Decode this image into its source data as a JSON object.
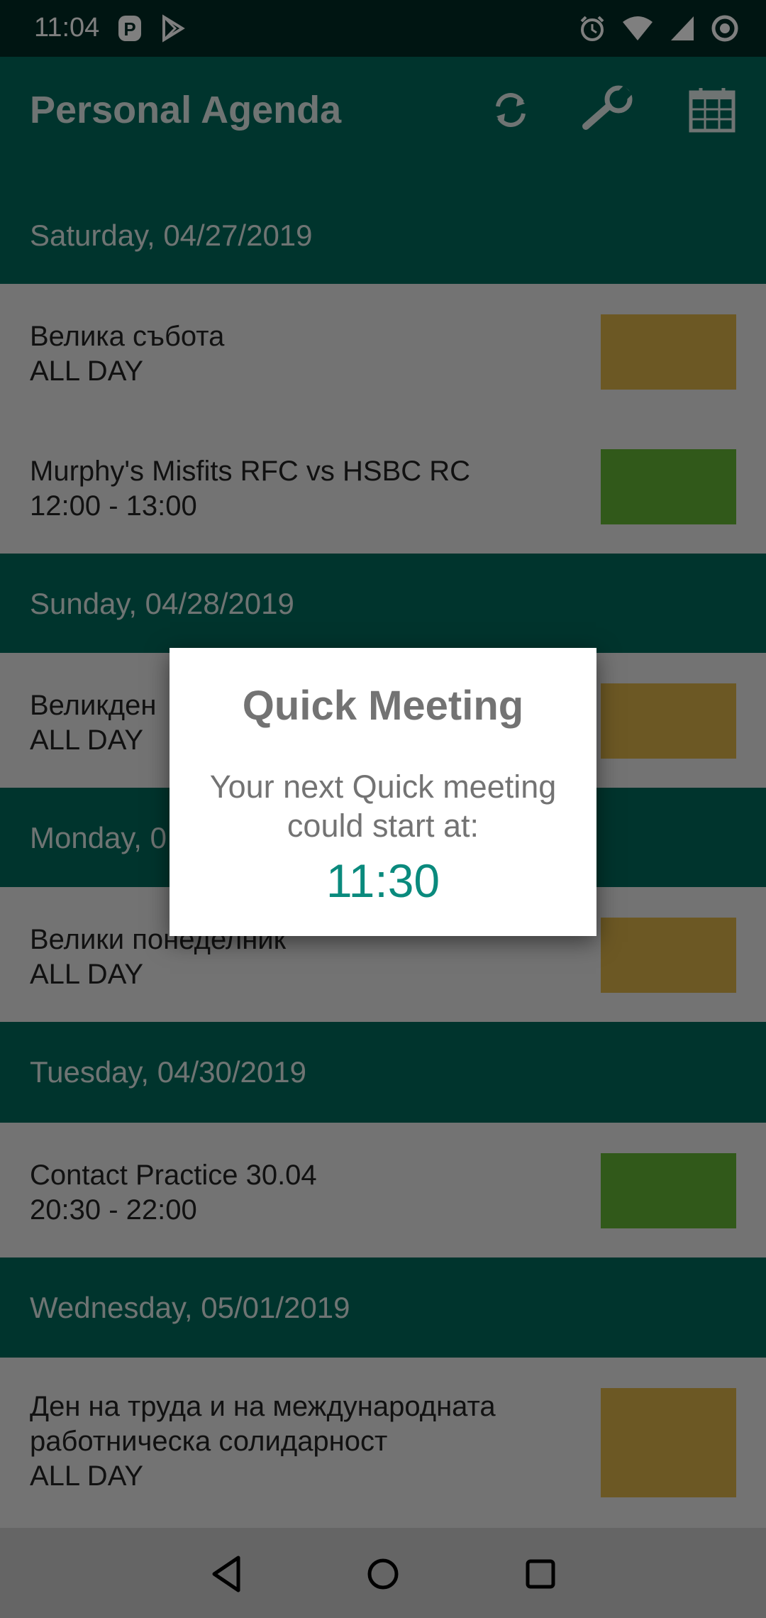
{
  "status_bar": {
    "time": "11:04",
    "left_icons": [
      "parking-icon",
      "play-store-icon"
    ],
    "right_icons": [
      "alarm-icon",
      "wifi-icon",
      "signal-icon",
      "sync-icon"
    ]
  },
  "app_bar": {
    "title": "Personal Agenda",
    "actions": [
      "refresh-icon",
      "wrench-icon",
      "calendar-icon"
    ]
  },
  "agenda": [
    {
      "date": "Saturday, 04/27/2019",
      "events": [
        {
          "title": "Велика събота",
          "time": "ALL DAY",
          "color": "#d9b048"
        },
        {
          "title": "Murphy's Misfits RFC vs HSBC RC",
          "time": "12:00 - 13:00",
          "color": "#62b334"
        }
      ]
    },
    {
      "date": "Sunday, 04/28/2019",
      "events": [
        {
          "title": "Великден",
          "time": "ALL DAY",
          "color": "#d9b048"
        }
      ]
    },
    {
      "date": "Monday, 0",
      "events": [
        {
          "title": "Велики понеделник",
          "time": "ALL DAY",
          "color": "#d9b048"
        }
      ]
    },
    {
      "date": "Tuesday, 04/30/2019",
      "events": [
        {
          "title": "Contact Practice 30.04",
          "time": "20:30 - 22:00",
          "color": "#62b334"
        }
      ]
    },
    {
      "date": "Wednesday, 05/01/2019",
      "events": [
        {
          "title": "Ден на труда и на международната работническа солидарност",
          "time": "ALL DAY",
          "color": "#d9b048"
        }
      ]
    }
  ],
  "dialog": {
    "title": "Quick Meeting",
    "message": "Your next Quick meeting could start at:",
    "time": "11:30"
  },
  "nav_bar": {
    "buttons": [
      "back-icon",
      "home-icon",
      "recents-icon"
    ]
  },
  "colors": {
    "status_bar": "#002a25",
    "app_bar": "#00695a",
    "accent": "#0a8a7d",
    "event_yellow": "#d9b048",
    "event_green": "#62b334"
  }
}
